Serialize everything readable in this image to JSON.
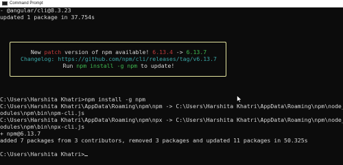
{
  "window": {
    "title": "Command Prompt",
    "icon": "terminal-icon"
  },
  "terminal": {
    "line1_prefix": "-",
    "line1_pkg": " @angular/cli@8.3.23",
    "line2": "updated 1 package in 37.754s",
    "notice": {
      "l1_a": "New ",
      "l1_b": "patch",
      "l1_c": " version of npm available! ",
      "l1_d": "6.13.4",
      "l1_e": " -> ",
      "l1_f": "6.13.7",
      "l2_a": "Changelog: ",
      "l2_b": "https://github.com/npm/cli/releases/tag/v6.13.7",
      "l3_a": "Run ",
      "l3_b": "npm install -g npm",
      "l3_c": " to update!"
    },
    "cmd_prompt": "C:\\Users\\Harshita Khatri>",
    "cmd_text": "npm install -g npm",
    "out1": "C:\\Users\\Harshita Khatri\\AppData\\Roaming\\npm\\npm -> C:\\Users\\Harshita Khatri\\AppData\\Roaming\\npm\\node_m",
    "out2": "odules\\npm\\bin\\npm-cli.js",
    "out3": "C:\\Users\\Harshita Khatri\\AppData\\Roaming\\npm\\npx -> C:\\Users\\Harshita Khatri\\AppData\\Roaming\\npm\\node_m",
    "out4": "odules\\npm\\bin\\npx-cli.js",
    "out5": "+ npm@6.13.7",
    "out6": "added 7 packages from 3 contributors, removed 3 packages and updated 11 packages in 50.325s",
    "final_prompt": "C:\\Users\\Harshita Khatri>"
  },
  "colors": {
    "background": "#0c0c0c",
    "text": "#d8d8d8",
    "highlight_red": "#c23b3b",
    "highlight_green": "#3fb950",
    "highlight_cyan": "#3aa6a6",
    "box_border": "#e6e6a0"
  }
}
